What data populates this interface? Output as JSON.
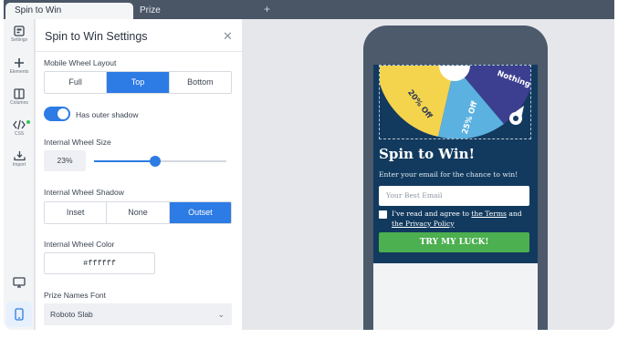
{
  "tabs": [
    {
      "label": "Spin to Win",
      "active": true
    },
    {
      "label": "Prize",
      "active": false
    }
  ],
  "add_tab_icon": "plus-icon",
  "sidebar": {
    "items": [
      {
        "label": "Settings",
        "icon": "settings-icon"
      },
      {
        "label": "Elements",
        "icon": "plus-icon"
      },
      {
        "label": "Columns",
        "icon": "columns-icon"
      },
      {
        "label": "CSS",
        "icon": "code-icon"
      },
      {
        "label": "Import",
        "icon": "import-icon"
      }
    ],
    "bottom": [
      {
        "icon": "desktop-icon"
      },
      {
        "icon": "mobile-icon",
        "active": true
      }
    ]
  },
  "panel": {
    "title": "Spin to Win Settings",
    "close_icon": "close-icon",
    "mobile_layout": {
      "label": "Mobile Wheel Layout",
      "options": [
        "Full",
        "Top",
        "Bottom"
      ],
      "selected": "Top"
    },
    "outer_shadow": {
      "label": "Has outer shadow",
      "on": true
    },
    "wheel_size": {
      "label": "Internal Wheel Size",
      "value": "23%",
      "fraction": 0.46
    },
    "wheel_shadow": {
      "label": "Internal Wheel Shadow",
      "options": [
        "Inset",
        "None",
        "Outset"
      ],
      "selected": "Outset"
    },
    "wheel_color": {
      "label": "Internal Wheel Color",
      "value": "#ffffff"
    },
    "prize_font": {
      "label": "Prize Names Font",
      "value": "Roboto Slab"
    }
  },
  "preview": {
    "wheel_segments": [
      "20% Off",
      "25% Off",
      "Nothing"
    ],
    "title": "Spin to Win!",
    "subtitle": "Enter your email for the chance to win!",
    "email_placeholder": "Your Best Email",
    "agree_prefix": "I've read and agree to ",
    "terms_link": "the Terms",
    "agree_and": " and ",
    "privacy_link": "the Privacy Policy",
    "cta": "TRY MY LUCK!"
  },
  "colors": {
    "accent": "#2d7be5",
    "popup_bg": "#123a5e",
    "cta": "#4caf50",
    "segment_yellow": "#f4d44d",
    "segment_blue": "#5bb1e0",
    "segment_navy": "#3c3f8f"
  }
}
